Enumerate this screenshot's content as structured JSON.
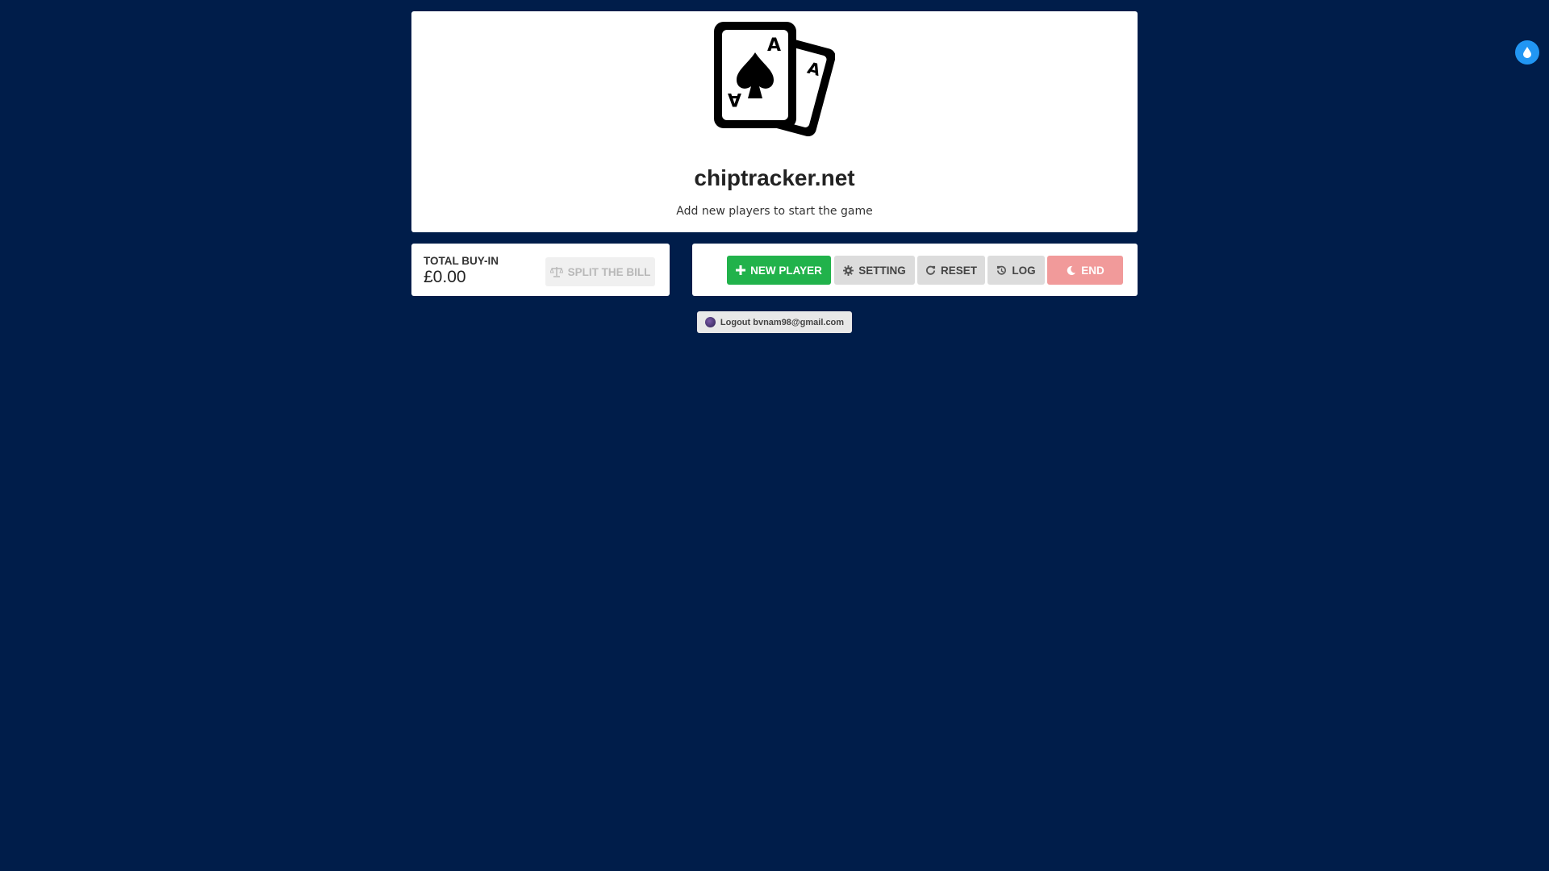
{
  "brand": {
    "logo_icon": "playing-cards-ace-of-spades-icon",
    "title": "chiptracker.net",
    "subtitle": "Add new players to start the game",
    "card_letter": "A"
  },
  "buyin": {
    "label": "TOTAL BUY-IN",
    "value": "£0.00",
    "split_button_label": "SPLIT THE BILL",
    "split_icon": "scale-icon"
  },
  "actions": {
    "new_player_label": "NEW PLAYER",
    "new_player_icon": "plus-icon",
    "setting_label": "SETTING",
    "setting_icon": "gear-icon",
    "reset_label": "RESET",
    "reset_icon": "redo-icon",
    "log_label": "LOG",
    "log_icon": "history-icon",
    "end_label": "END",
    "end_icon": "moon-icon"
  },
  "account": {
    "logout_label": "Logout bvnam98@gmail.com"
  },
  "theme_toggle": {
    "icon": "droplet-icon"
  },
  "colors": {
    "background": "#001d4a",
    "new_player": "#21b24b",
    "end": "#f19a9a",
    "theme_toggle": "#2196f3"
  }
}
